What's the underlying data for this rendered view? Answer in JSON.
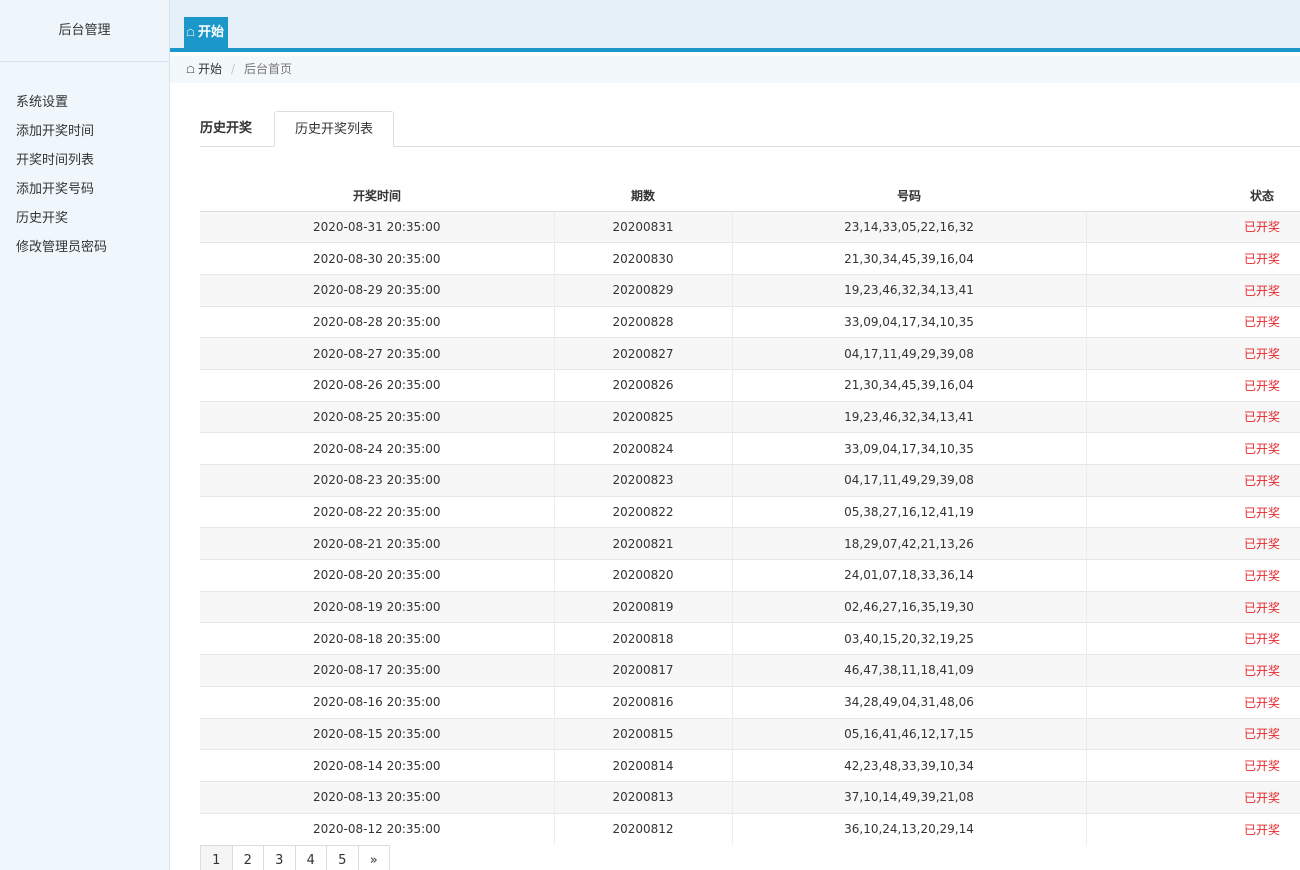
{
  "sidebar": {
    "brand": "后台管理",
    "items": [
      {
        "label": "系统设置"
      },
      {
        "label": "添加开奖时间"
      },
      {
        "label": "开奖时间列表"
      },
      {
        "label": "添加开奖号码"
      },
      {
        "label": "历史开奖"
      },
      {
        "label": "修改管理员密码"
      }
    ]
  },
  "topbar": {
    "start_tab": "开始",
    "start_icon": "home-icon"
  },
  "breadcrumb": {
    "home": "开始",
    "current": "后台首页",
    "separator": "/"
  },
  "tabs": {
    "title": "历史开奖",
    "list": "历史开奖列表"
  },
  "table": {
    "headers": [
      "开奖时间",
      "期数",
      "号码",
      "状态"
    ],
    "rows": [
      [
        "2020-08-31 20:35:00",
        "20200831",
        "23,14,33,05,22,16,32",
        "已开奖"
      ],
      [
        "2020-08-30 20:35:00",
        "20200830",
        "21,30,34,45,39,16,04",
        "已开奖"
      ],
      [
        "2020-08-29 20:35:00",
        "20200829",
        "19,23,46,32,34,13,41",
        "已开奖"
      ],
      [
        "2020-08-28 20:35:00",
        "20200828",
        "33,09,04,17,34,10,35",
        "已开奖"
      ],
      [
        "2020-08-27 20:35:00",
        "20200827",
        "04,17,11,49,29,39,08",
        "已开奖"
      ],
      [
        "2020-08-26 20:35:00",
        "20200826",
        "21,30,34,45,39,16,04",
        "已开奖"
      ],
      [
        "2020-08-25 20:35:00",
        "20200825",
        "19,23,46,32,34,13,41",
        "已开奖"
      ],
      [
        "2020-08-24 20:35:00",
        "20200824",
        "33,09,04,17,34,10,35",
        "已开奖"
      ],
      [
        "2020-08-23 20:35:00",
        "20200823",
        "04,17,11,49,29,39,08",
        "已开奖"
      ],
      [
        "2020-08-22 20:35:00",
        "20200822",
        "05,38,27,16,12,41,19",
        "已开奖"
      ],
      [
        "2020-08-21 20:35:00",
        "20200821",
        "18,29,07,42,21,13,26",
        "已开奖"
      ],
      [
        "2020-08-20 20:35:00",
        "20200820",
        "24,01,07,18,33,36,14",
        "已开奖"
      ],
      [
        "2020-08-19 20:35:00",
        "20200819",
        "02,46,27,16,35,19,30",
        "已开奖"
      ],
      [
        "2020-08-18 20:35:00",
        "20200818",
        "03,40,15,20,32,19,25",
        "已开奖"
      ],
      [
        "2020-08-17 20:35:00",
        "20200817",
        "46,47,38,11,18,41,09",
        "已开奖"
      ],
      [
        "2020-08-16 20:35:00",
        "20200816",
        "34,28,49,04,31,48,06",
        "已开奖"
      ],
      [
        "2020-08-15 20:35:00",
        "20200815",
        "05,16,41,46,12,17,15",
        "已开奖"
      ],
      [
        "2020-08-14 20:35:00",
        "20200814",
        "42,23,48,33,39,10,34",
        "已开奖"
      ],
      [
        "2020-08-13 20:35:00",
        "20200813",
        "37,10,14,49,39,21,08",
        "已开奖"
      ],
      [
        "2020-08-12 20:35:00",
        "20200812",
        "36,10,24,13,20,29,14",
        "已开奖"
      ]
    ]
  },
  "pagination": {
    "pages": [
      "1",
      "2",
      "3",
      "4",
      "5",
      "»"
    ],
    "current": "1"
  },
  "colors": {
    "accent": "#1b98c9",
    "status_red": "#e5282c"
  }
}
